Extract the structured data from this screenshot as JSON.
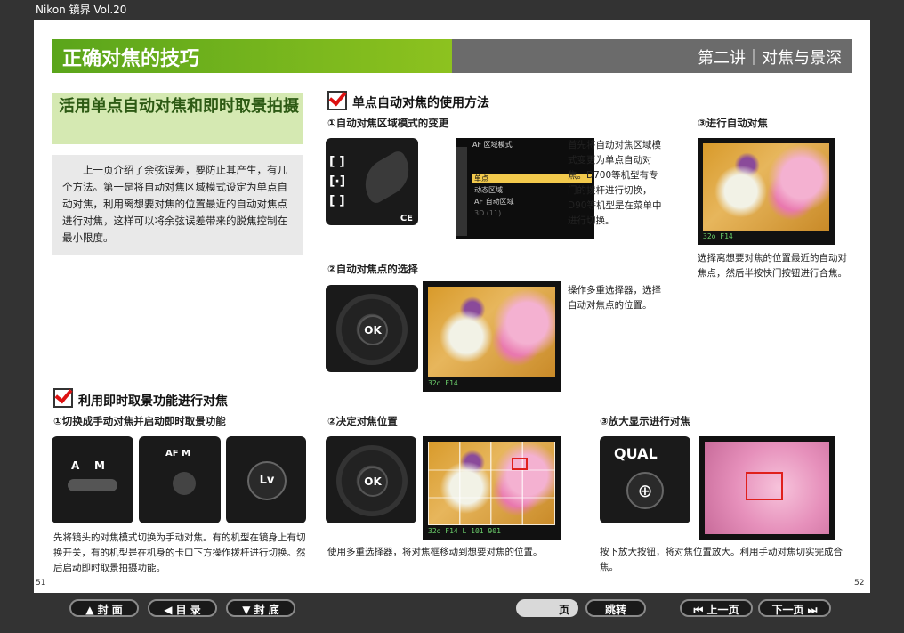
{
  "app": {
    "title": "Nikon 镜界 Vol.20"
  },
  "header": {
    "title": "正确对焦的技巧",
    "section": "第二讲｜对焦与景深"
  },
  "left": {
    "subhead": "活用单点自动对焦和即时取景拍摄",
    "intro": "上一页介绍了余弦误差，要防止其产生，有几个方法。第一是将自动对焦区域模式设定为单点自动对焦，利用离想要对焦的位置最近的自动对焦点进行对焦，这样可以将余弦误差带来的脱焦控制在最小限度。"
  },
  "sec1": {
    "title": "单点自动对焦的使用方法",
    "step1": {
      "title": "①自动对焦区域模式的变更",
      "desc": "首先将自动对焦区域模式变更为单点自动对焦。D700等机型有专门的拨杆进行切换，D90等机型是在菜单中进行切换。"
    },
    "menu": {
      "header": "AF 区域模式",
      "items": [
        "单点",
        "动态区域",
        "AF 自动区域",
        "3D (11)"
      ]
    },
    "step2": {
      "title": "②自动对焦点的选择",
      "desc": "操作多重选择器，选择自动对焦点的位置。"
    },
    "step3": {
      "title": "③进行自动对焦",
      "desc": "选择离想要对焦的位置最近的自动对焦点，然后半按快门按钮进行合焦。"
    }
  },
  "sec2": {
    "title": "利用即时取景功能进行对焦",
    "step1": {
      "title": "①切换成手动对焦并启动即时取景功能",
      "desc": "先将镜头的对焦模式切换为手动对焦。有的机型在镜身上有切换开关，有的机型是在机身的卡口下方操作拨杆进行切换。然后启动即时取景拍摄功能。"
    },
    "step2": {
      "title": "②决定对焦位置",
      "desc": "使用多重选择器，将对焦框移动到想要对焦的位置。"
    },
    "step3": {
      "title": "③放大显示进行对焦",
      "desc": "按下放大按钮，将对焦位置放大。利用手动对焦切实完成合焦。"
    }
  },
  "camera_labels": {
    "ok": "OK",
    "qual": "QUAL",
    "a": "A",
    "m": "M",
    "af": "AF",
    "lv": "Lv",
    "zoom": "⊕",
    "ce": "CE"
  },
  "lcd": {
    "info1": "32o  F14",
    "info2": "32o  F14",
    "info3": "32o  F14  L 101  901"
  },
  "page_numbers": {
    "left": "51",
    "right": "52"
  },
  "nav": {
    "cover": "▲ 封  面",
    "toc": "◀ 目  录",
    "back": "▼ 封  底",
    "page_label": "页",
    "page_input": "",
    "jump": "跳转",
    "prev": "⏮ 上一页",
    "next": "下一页 ⏭"
  }
}
